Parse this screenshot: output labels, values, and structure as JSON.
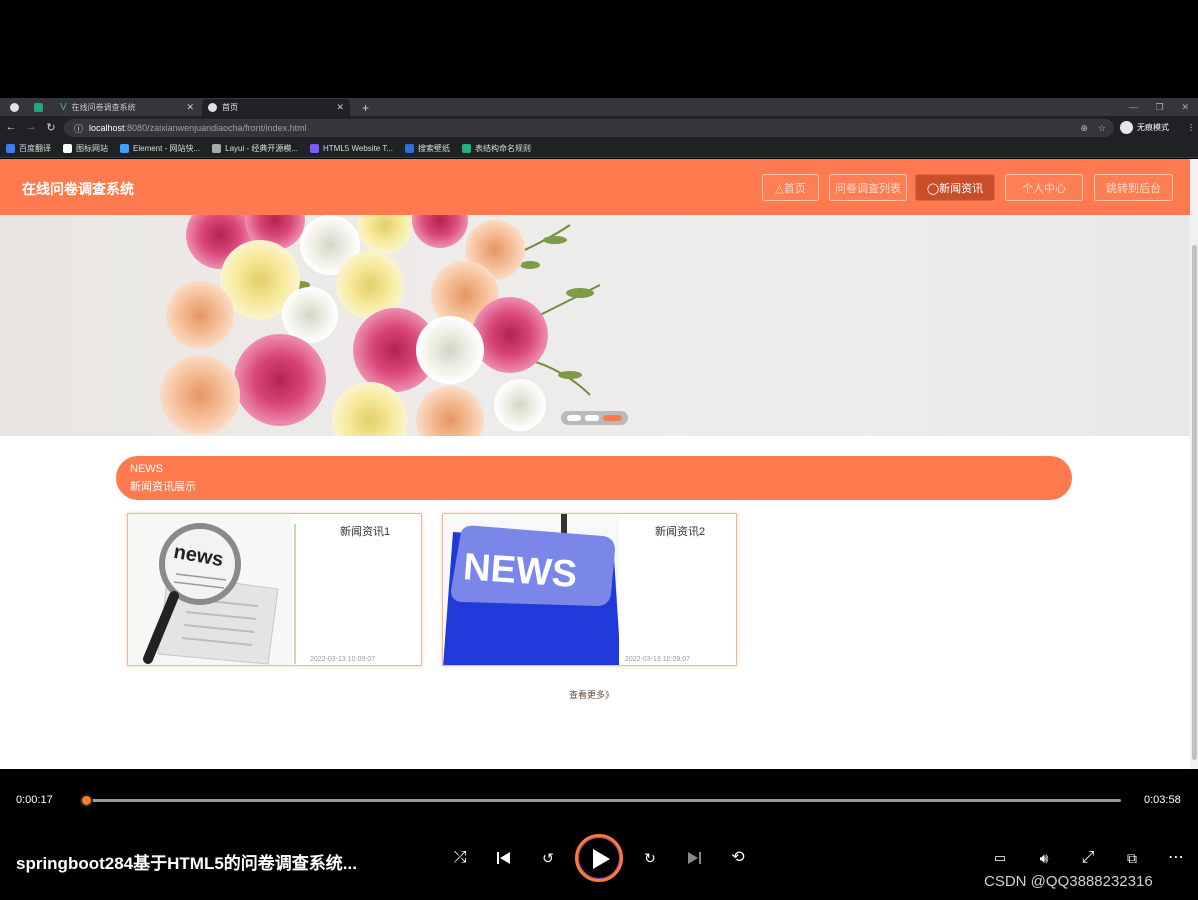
{
  "browser": {
    "tabs": [
      {
        "label": "在线问卷调查系统",
        "active": false
      },
      {
        "label": "首页",
        "active": true
      }
    ],
    "url_host": "localhost",
    "url_path": ":8080/zaixianwenjuandiaocha/front/index.html",
    "incognito_label": "无痕模式",
    "bookmarks": [
      "百度翻译",
      "图标网站",
      "Element - 网站快...",
      "Layui - 经典开源模...",
      "HTML5 Website T...",
      "搜索壁纸",
      "表结构命名规则"
    ]
  },
  "site": {
    "title": "在线问卷调查系统",
    "nav": [
      {
        "label": "△首页",
        "active": false
      },
      {
        "label": "问卷调查列表",
        "active": false
      },
      {
        "label": "◯新闻资讯",
        "active": true
      },
      {
        "label": "个人中心",
        "active": false
      },
      {
        "label": "跳转到后台",
        "active": false
      }
    ],
    "carousel": {
      "slides": 3,
      "active_index": 2
    }
  },
  "news": {
    "title_en": "NEWS",
    "title_cn": "新闻资讯展示",
    "items": [
      {
        "title": "新闻资讯1",
        "date": "2022-03-13 10:09:07",
        "image": "magnifier-newspaper-image"
      },
      {
        "title": "新闻资讯2",
        "date": "2022-03-13 10:09:07",
        "image": "news-key-image"
      }
    ],
    "more_label": "查看更多》"
  },
  "player": {
    "current_time": "0:00:17",
    "total_time": "0:03:58",
    "progress": 0.071,
    "video_title": "springboot284基于HTML5的问卷调查系统...",
    "watermark": "CSDN @QQ3888232316",
    "accent": "#ff7b2f"
  },
  "theme": {
    "primary": "#ff7b4f"
  }
}
